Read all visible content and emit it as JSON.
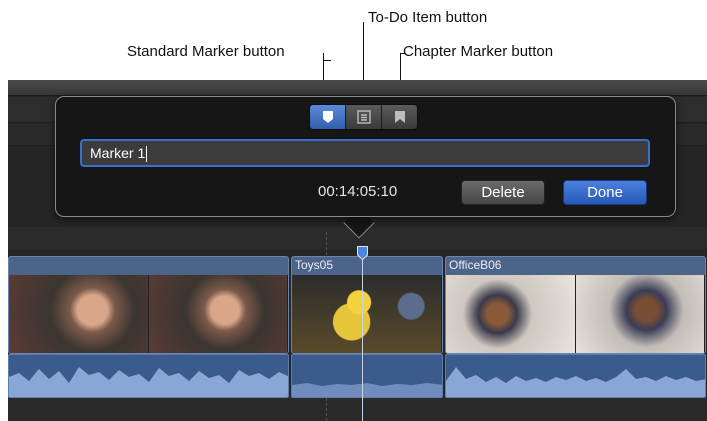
{
  "callouts": {
    "todo": "To-Do Item button",
    "standard": "Standard Marker button",
    "chapter": "Chapter Marker button"
  },
  "marker_popover": {
    "name_value": "Marker 1",
    "timecode": "00:14:05:10",
    "delete_label": "Delete",
    "done_label": "Done",
    "marker_types": [
      {
        "name": "standard",
        "icon": "standard-marker-icon",
        "active": true
      },
      {
        "name": "todo",
        "icon": "todo-item-icon",
        "active": false
      },
      {
        "name": "chapter",
        "icon": "chapter-marker-icon",
        "active": false
      }
    ]
  },
  "timeline": {
    "clips": [
      {
        "title": ""
      },
      {
        "title": "Toys05"
      },
      {
        "title": "OfficeB06"
      }
    ]
  },
  "colors": {
    "accent": "#2f5eaa",
    "clip": "#4c6489",
    "audio": "#3b5b8c"
  }
}
